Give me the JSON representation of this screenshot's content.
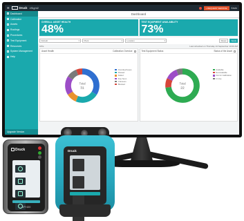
{
  "topbar": {
    "brand": "Druck",
    "app_name": "4Sight2",
    "action_button": "+ REQUEST SERVICE",
    "user_label": "Kevin"
  },
  "sidebar": {
    "items": [
      {
        "label": "Dashboard",
        "icon": "dashboard-icon",
        "active": true
      },
      {
        "label": "Calibration",
        "icon": "calibration-icon"
      },
      {
        "label": "Assets",
        "icon": "assets-icon"
      },
      {
        "label": "Routings",
        "icon": "routings-icon"
      },
      {
        "label": "Procedures",
        "icon": "procedures-icon"
      },
      {
        "label": "Test Equipment",
        "icon": "test-equipment-icon"
      },
      {
        "label": "Resources",
        "icon": "resources-icon"
      },
      {
        "label": "System Management",
        "icon": "system-management-icon"
      },
      {
        "label": "Help",
        "icon": "help-icon"
      }
    ],
    "bottom_label": "Upgrade Version"
  },
  "main": {
    "page_title": "Dashboard",
    "tiles": [
      {
        "label": "OVERALL ASSET HEALTH",
        "value": "48%"
      },
      {
        "label": "TEST EQUIPMENT AVAILABILITY",
        "value": "73%"
      }
    ],
    "filters": {
      "site": "Default",
      "plant": "Plant",
      "location": "Location",
      "reset_label": "Reset",
      "apply_label": "Apply"
    },
    "sub_row": {
      "left": "KPIs",
      "right": "Last refreshed on Thursday 13 September 10:00 AM"
    },
    "panels": [
      {
        "title": "Asset Health",
        "right_label": "Calibration Overdue",
        "center_label": "Total",
        "center_value": "31",
        "legend": [
          {
            "label": "Overdue/Issues",
            "color": "#2f6fd0"
          },
          {
            "label": "Passed",
            "color": "#1aa9ad"
          },
          {
            "label": "Failed",
            "color": "#e8932e"
          },
          {
            "label": "Due Soon",
            "color": "#9c4dc7"
          },
          {
            "label": "Unknown",
            "color": "#7a7a7a"
          },
          {
            "label": "Blocked",
            "color": "#d6453a"
          }
        ],
        "segments": [
          {
            "value": 34,
            "color": "#2f6fd0"
          },
          {
            "value": 22,
            "color": "#1aa9ad"
          },
          {
            "value": 10,
            "color": "#e8932e"
          },
          {
            "value": 18,
            "color": "#9c4dc7"
          },
          {
            "value": 10,
            "color": "#7a7a7a"
          },
          {
            "value": 6,
            "color": "#d6453a"
          }
        ]
      },
      {
        "title": "Test Equipment Status",
        "right_label": "Status of the Asset",
        "center_label": "Total",
        "center_value": "22",
        "legend": [
          {
            "label": "Available",
            "color": "#2eab52"
          },
          {
            "label": "Not Available",
            "color": "#d6453a"
          },
          {
            "label": "Out for Calibration",
            "color": "#9c4dc7"
          },
          {
            "label": "In Use",
            "color": "#7a7a7a"
          }
        ],
        "segments": [
          {
            "value": 73,
            "color": "#2eab52"
          },
          {
            "value": 9,
            "color": "#d6453a"
          },
          {
            "value": 12,
            "color": "#9c4dc7"
          },
          {
            "value": 6,
            "color": "#7a7a7a"
          }
        ]
      }
    ]
  },
  "devices": {
    "small_brand": "Druck",
    "small_label": "DPI 620",
    "big_brand": "Druck"
  }
}
